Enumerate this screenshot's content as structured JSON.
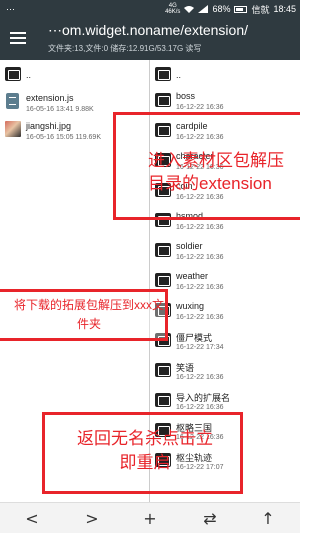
{
  "status_bar": {
    "left_text": "⋯",
    "network": "4G\n46K/s",
    "battery": "68%",
    "carrier": "信就",
    "time": "18:45"
  },
  "app_bar": {
    "menu_icon": "hamburger-icon",
    "path": "⋯om.widget.noname/extension/",
    "info": "文件夹:13,文件:0  储存:12.91G/53.17G  读写"
  },
  "left_pane": {
    "items": [
      {
        "name": "..",
        "meta": "",
        "icon": "folder-icon"
      },
      {
        "name": "extension.js",
        "meta": "16-05-16 13:41  9.88K",
        "icon": "file-icon"
      },
      {
        "name": "jiangshi.jpg",
        "meta": "16-05-16 15:05  119.69K",
        "icon": "image-thumbnail"
      }
    ]
  },
  "right_pane": {
    "items": [
      {
        "name": "..",
        "meta": ""
      },
      {
        "name": "boss",
        "meta": "16-12-22 16:36"
      },
      {
        "name": "cardpile",
        "meta": "16-12-22 16:36"
      },
      {
        "name": "character",
        "meta": "16-12-22 16:36"
      },
      {
        "name": "coin",
        "meta": "16-12-22 16:36"
      },
      {
        "name": "hsmod",
        "meta": "16-12-22 16:36"
      },
      {
        "name": "soldier",
        "meta": "16-12-22 16:36"
      },
      {
        "name": "weather",
        "meta": "16-12-22 16:36"
      },
      {
        "name": "wuxing",
        "meta": "16-12-22 16:36"
      },
      {
        "name": "僵尸模式",
        "meta": "16-12-22 17:34"
      },
      {
        "name": "笑语",
        "meta": "16-12-22 16:36"
      },
      {
        "name": "导入的扩展名",
        "meta": "16-12-22 16:36"
      },
      {
        "name": "枢略三国",
        "meta": "16-12-22 16:36"
      },
      {
        "name": "枢尘轨迹",
        "meta": "16-12-22 17:07"
      }
    ]
  },
  "annotations": {
    "top_right": "进入素材区包解压\n目录的extension",
    "middle_left": "将下载的拓展包解压到xxx文件夹",
    "bottom": "返回无名杀点击立即重启"
  },
  "bottom_bar": {
    "back": "<",
    "forward": ">",
    "add": "+",
    "swap": "⇄",
    "up": "↑"
  },
  "colors": {
    "bar": "#2f3a40",
    "annotation": "#e8242a"
  }
}
